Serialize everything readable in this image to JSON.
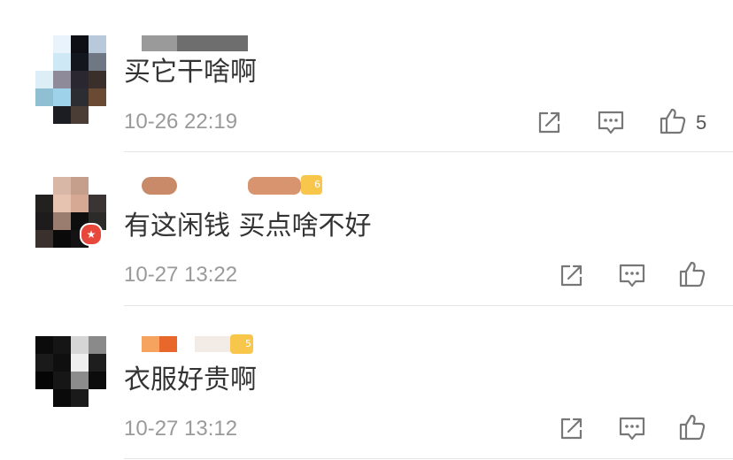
{
  "comments": [
    {
      "text": "买它干啥啊",
      "time": "10-26 22:19",
      "like_count": "5"
    },
    {
      "text": "有这闲钱 买点啥不好",
      "time": "10-27 13:22",
      "like_count": ""
    },
    {
      "text": "衣服好贵啊",
      "time": "10-27 13:12",
      "like_count": ""
    }
  ],
  "icons": {
    "share": "share-icon",
    "reply": "comment-icon",
    "like": "thumbs-up-icon"
  },
  "colors": {
    "text": "#333333",
    "meta": "#9a9a9a",
    "icon": "#777777",
    "divider": "#e6e6e6"
  }
}
